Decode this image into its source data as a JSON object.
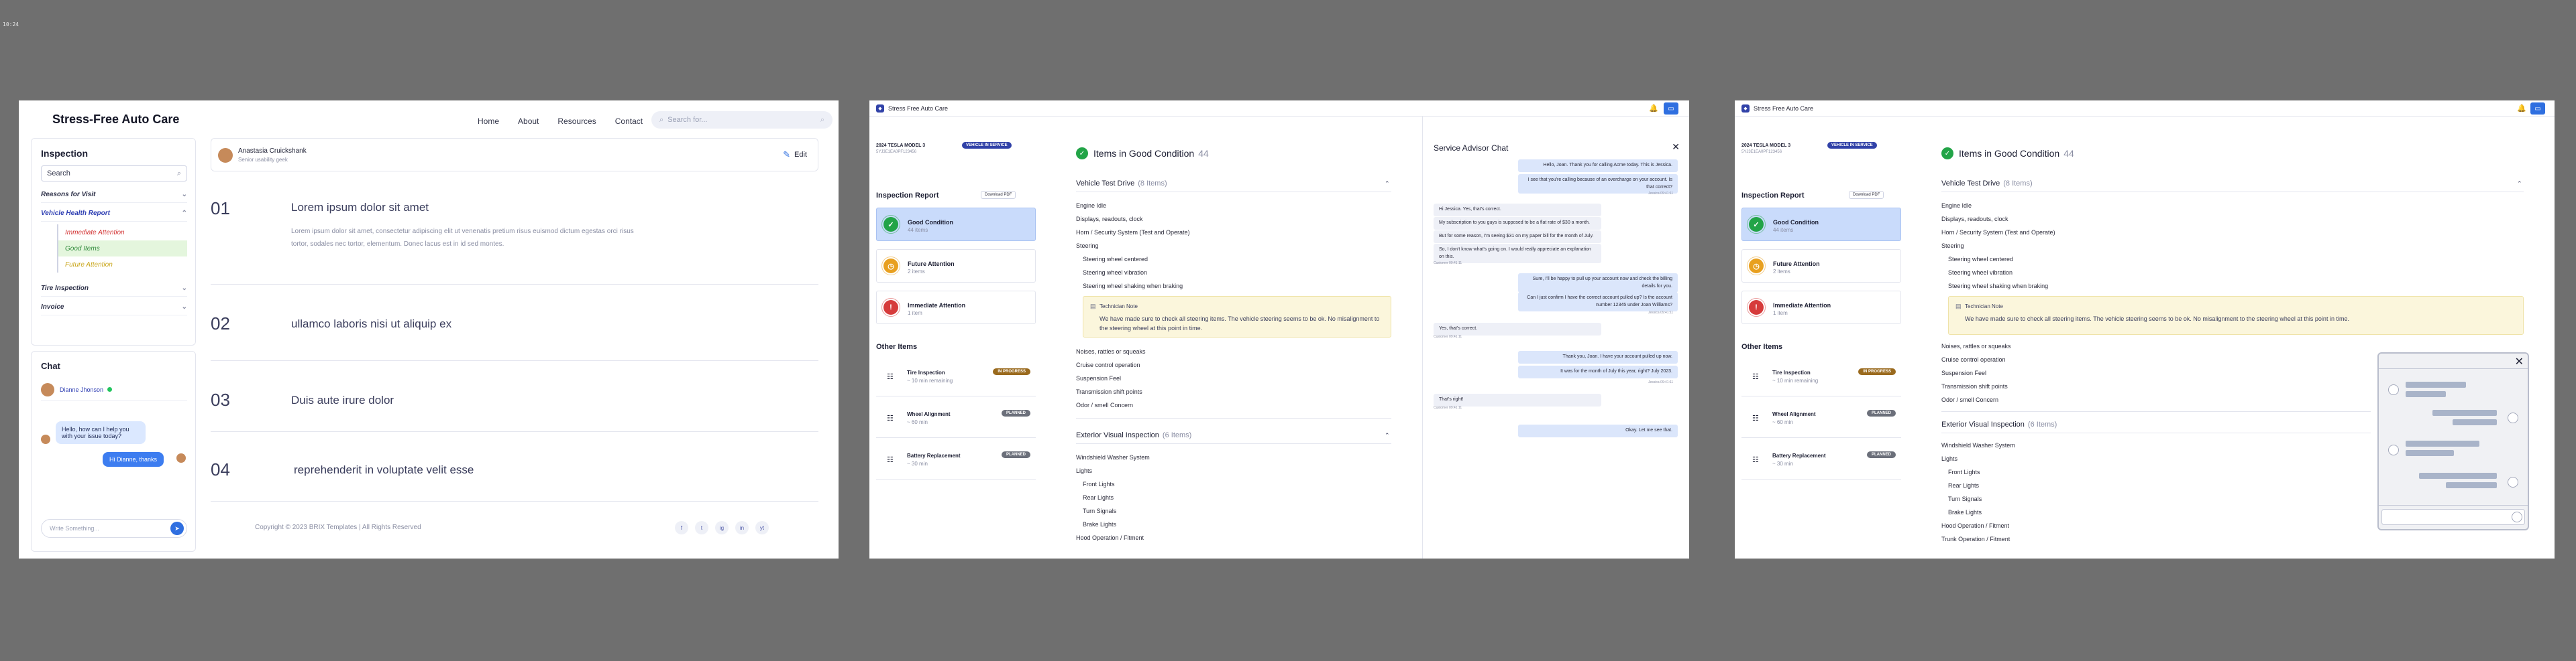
{
  "canvas_label": "10:24",
  "ab1": {
    "brand": "Stress-Free Auto Care",
    "nav": [
      "Home",
      "About",
      "Resources",
      "Contact"
    ],
    "search_placeholder": "Search for...",
    "sidebar": {
      "title": "Inspection",
      "search_value": "Search",
      "menu": [
        "Reasons for Visit",
        "Vehicle Health Report",
        "Tire Inspection",
        "Invoice"
      ],
      "sub_items": [
        "Immediate Attention",
        "Good Items",
        "Future Attention"
      ]
    },
    "chat": {
      "title": "Chat",
      "user": "Dianne Jhonson",
      "incoming": "Hello, how can I help you with your issue today?",
      "outgoing": "Hi Dianne, thanks",
      "input_placeholder": "Write Something..."
    },
    "profile": {
      "name": "Anastasia Cruickshank",
      "role": "Senior usability geek",
      "edit_label": "Edit"
    },
    "sections": [
      {
        "num": "01",
        "title": "Lorem ipsum dolor sit amet",
        "body": "Lorem ipsum dolor sit amet, consectetur adipiscing elit ut venenatis pretium risus euismod dictum egestas orci risus tortor, sodales nec tortor, elementum. Donec lacus est in id sed montes."
      },
      {
        "num": "02",
        "title": "ullamco laboris nisi ut aliquip ex"
      },
      {
        "num": "03",
        "title": "Duis aute irure dolor"
      },
      {
        "num": "04",
        "title": "reprehenderit in voluptate velit esse"
      }
    ],
    "footer": "Copyright © 2023 BRIX Templates | All Rights Reserved",
    "socials": [
      "f",
      "t",
      "ig",
      "in",
      "yt"
    ]
  },
  "app": {
    "name": "Stress Free Auto Care",
    "car": "2024 TESLA MODEL 3",
    "vin": "5YJ3E1EA0PF123456",
    "vehicle_badge": "VEHICLE IN SERVICE",
    "inspection_title": "Inspection Report",
    "download_label": "Download PDF",
    "status_cards": [
      {
        "label": "Good Condition",
        "count": "44 items",
        "color": "#22a447"
      },
      {
        "label": "Future Attention",
        "count": "2 items",
        "color": "#e8a020"
      },
      {
        "label": "Immediate Attention",
        "count": "1 item",
        "color": "#d63b3b"
      }
    ],
    "other_title": "Other Items",
    "other_items": [
      {
        "name": "Tire Inspection",
        "eta": "~ 10 min remaining",
        "status": "IN PROGRESS",
        "color": "#9a6a1e"
      },
      {
        "name": "Wheel Alignment",
        "eta": "~ 60 min",
        "status": "PLANNED",
        "color": "#6b6f7a"
      },
      {
        "name": "Battery Replacement",
        "eta": "~ 30 min",
        "status": "PLANNED",
        "color": "#6b6f7a"
      }
    ],
    "good_heading": "Items in Good Condition",
    "good_count": "44",
    "test_drive_heading": "Vehicle Test Drive",
    "test_drive_count": "(8 Items)",
    "test_drive_items": [
      "Engine Idle",
      "Displays, readouts, clock",
      "Horn / Security System (Test and Operate)",
      "Steering"
    ],
    "steering_items": [
      "Steering wheel centered",
      "Steering wheel vibration",
      "Steering wheel shaking when braking"
    ],
    "note_title": "Technician Note",
    "note_body_1": "We have made sure to check all steering items. The vehicle steering seems to be ok. No",
    "note_body_2": "misalignment to the steering wheel at this point in time.",
    "note_body_full": "We have made sure to check all steering items. The vehicle steering seems to be ok. No misalignment to the steering wheel at this point in time.",
    "after_note_items": [
      "Noises, rattles or squeaks",
      "Cruise control operation",
      "Suspension Feel",
      "Transmission shift points",
      "Odor / smell Concern"
    ],
    "exterior_heading": "Exterior Visual Inspection",
    "exterior_count": "(6 Items)",
    "exterior_items": [
      "Windshield Washer System",
      "Lights"
    ],
    "light_items": [
      "Front Lights",
      "Rear Lights",
      "Turn Signals",
      "Brake Lights"
    ],
    "exterior_tail": [
      "Hood Operation / Fitment",
      "Trunk Operation / Fitment"
    ]
  },
  "service_chat": {
    "title": "Service Advisor Chat",
    "messages": [
      {
        "dir": "out",
        "text": "Hello, Joan. Thank you for calling Acme today. This is Jessica."
      },
      {
        "dir": "out",
        "text": "I see that you're calling because of an overcharge on your account. Is that correct?",
        "meta": "Jessica 09:41:11"
      },
      {
        "dir": "in",
        "text": "Hi Jessica. Yes, that's correct."
      },
      {
        "dir": "in",
        "text": "My subscription to you guys is supposed to be a flat rate of $30 a month."
      },
      {
        "dir": "in",
        "text": "But for some reason, I'm seeing $31 on my paper bill for the month of July."
      },
      {
        "dir": "in",
        "text": "So, I don't know what's going on. I would really appreciate an explanation on this.",
        "meta": "Customer 09:41:11"
      },
      {
        "dir": "out",
        "text": "Sure, I'll be happy to pull up your account now and check the billing details for you."
      },
      {
        "dir": "out",
        "text": "Can I just confirm I have the correct account pulled up? Is the account number 12345 under Joan Williams?",
        "meta": "Jessica 09:41:11"
      },
      {
        "dir": "in",
        "text": "Yes, that's correct.",
        "meta": "Customer 09:41:11"
      },
      {
        "dir": "out",
        "text": "Thank you, Joan. I have your account pulled up now."
      },
      {
        "dir": "out",
        "text": "It was for the month of July this year, right? July 2023.",
        "meta": "Jessica 09:41:11"
      },
      {
        "dir": "in",
        "text": "That's right!",
        "meta": "Customer 09:41:11"
      },
      {
        "dir": "out",
        "text": "Okay. Let me see that."
      }
    ]
  }
}
